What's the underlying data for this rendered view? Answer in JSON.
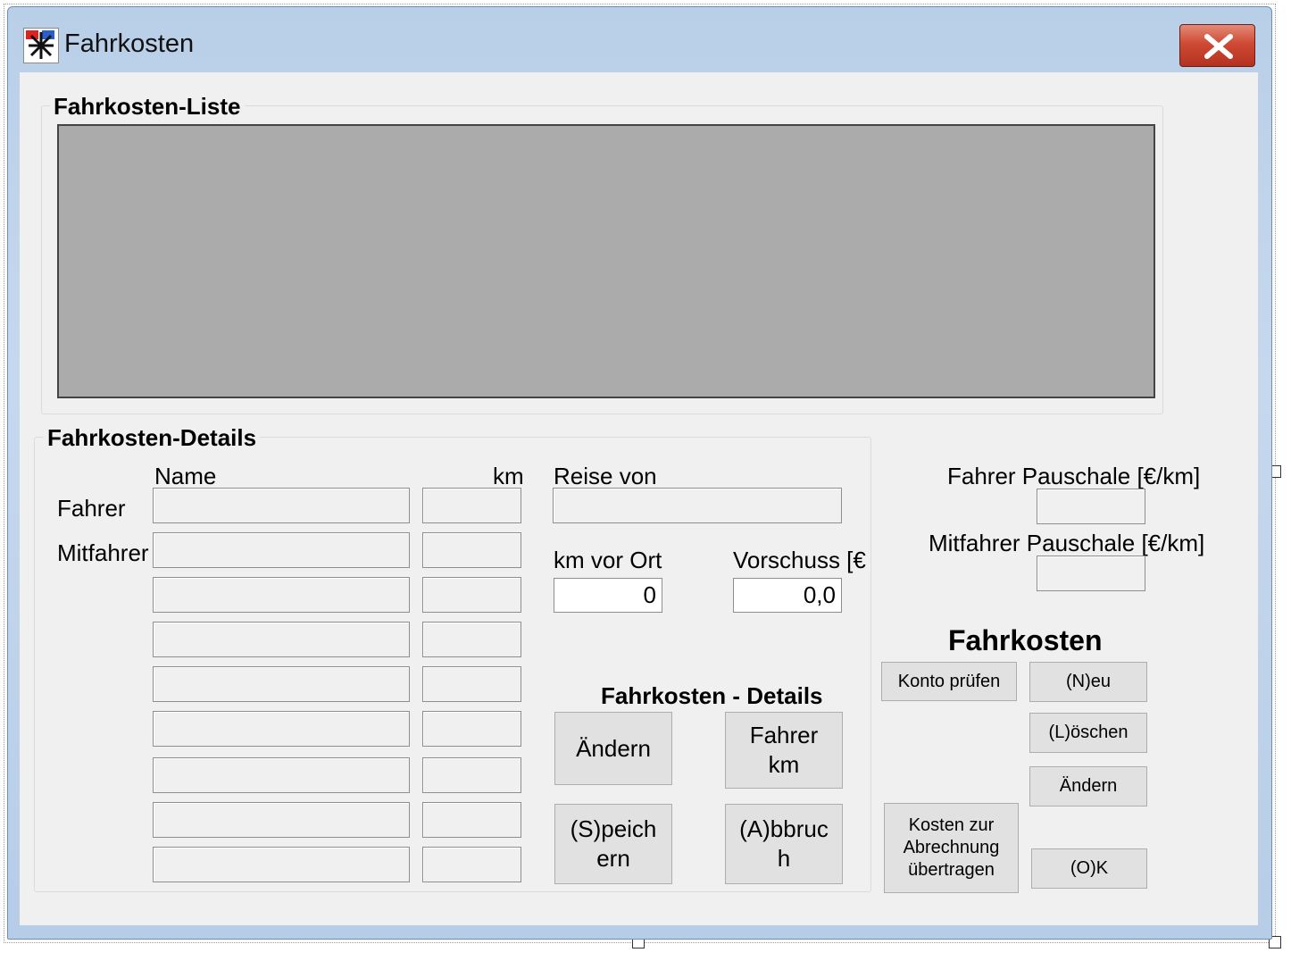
{
  "window": {
    "title": "Fahrkosten",
    "close_icon": "close-icon",
    "app_icon": "app-icon"
  },
  "list_group": {
    "title": "Fahrkosten-Liste"
  },
  "details_group": {
    "title": "Fahrkosten-Details",
    "col_name": "Name",
    "col_km": "km",
    "row_driver": "Fahrer",
    "row_passenger": "Mitfahrer",
    "reise_von_label": "Reise von",
    "reise_von_value": "",
    "km_vor_ort_label": "km vor Ort",
    "km_vor_ort_value": "0",
    "vorschuss_label": "Vorschuss [€",
    "vorschuss_value": "0,0",
    "passenger_rows": [
      {
        "name": "",
        "km": ""
      },
      {
        "name": "",
        "km": ""
      },
      {
        "name": "",
        "km": ""
      },
      {
        "name": "",
        "km": ""
      },
      {
        "name": "",
        "km": ""
      },
      {
        "name": "",
        "km": ""
      },
      {
        "name": "",
        "km": ""
      },
      {
        "name": "",
        "km": ""
      },
      {
        "name": "",
        "km": ""
      }
    ],
    "subtitle": "Fahrkosten - Details",
    "btn_aendern": "Ändern",
    "btn_fahrer_km_1": "Fahrer",
    "btn_fahrer_km_2": "km",
    "btn_speichern_1": "(S)peich",
    "btn_speichern_2": "ern",
    "btn_abbruch_1": "(A)bbruc",
    "btn_abbruch_2": "h"
  },
  "pauschale": {
    "fahrer_label": "Fahrer Pauschale [€/km]",
    "fahrer_value": "",
    "mitfahrer_label": "Mitfahrer Pauschale [€/km]",
    "mitfahrer_value": ""
  },
  "fahrkosten_panel": {
    "heading": "Fahrkosten",
    "btn_konto": "Konto prüfen",
    "btn_neu": "(N)eu",
    "btn_loeschen": "(L)öschen",
    "btn_aendern": "Ändern",
    "btn_kosten_1": "Kosten zur",
    "btn_kosten_2": "Abrechnung",
    "btn_kosten_3": "übertragen",
    "btn_ok": "(O)K"
  }
}
